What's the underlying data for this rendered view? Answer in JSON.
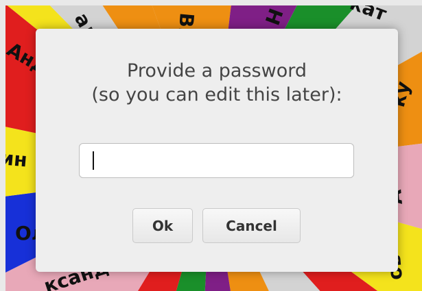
{
  "background": {
    "segment_labels": [
      "Ви",
      "Н",
      "кат",
      "ку",
      "А",
      "ов",
      "Анде",
      "ин",
      "Ол",
      "ксанд",
      "алл"
    ]
  },
  "dialog": {
    "prompt_line1": "Provide a password",
    "prompt_line2": "(so you can edit this later):",
    "password_value": "",
    "ok_label": "Ok",
    "cancel_label": "Cancel"
  },
  "colors": {
    "dialog_bg": "#eeeeee",
    "page_bg": "#e9e9e9",
    "segment_red": "#e01e1e",
    "segment_yellow": "#f4e31c",
    "segment_orange": "#ee8f12",
    "segment_purple": "#7f1f86",
    "segment_green": "#1a8f2a",
    "segment_blue": "#1730d8",
    "segment_pink": "#e8a8b8",
    "segment_gray": "#d3d3d3"
  }
}
